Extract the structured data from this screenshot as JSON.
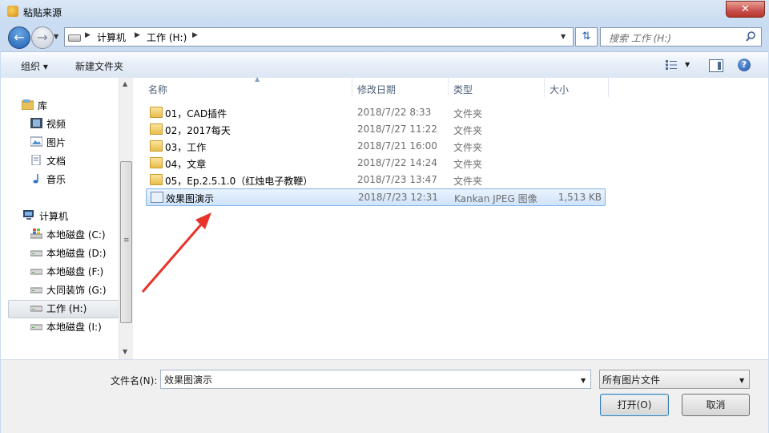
{
  "window": {
    "title": "粘贴来源",
    "close_glyph": "✕"
  },
  "nav": {
    "breadcrumbs": [
      "计算机",
      "工作 (H:)"
    ],
    "search_placeholder": "搜索 工作 (H:)"
  },
  "toolbar": {
    "organize_label": "组织 ▾",
    "new_folder_label": "新建文件夹",
    "help_glyph": "?"
  },
  "sidebar": {
    "libraries_label": "库",
    "library_items": [
      {
        "label": "视频",
        "icon": "video-icon"
      },
      {
        "label": "图片",
        "icon": "picture-icon"
      },
      {
        "label": "文档",
        "icon": "document-icon"
      },
      {
        "label": "音乐",
        "icon": "music-icon"
      }
    ],
    "computer_label": "计算机",
    "drives": [
      {
        "label": "本地磁盘 (C:)",
        "icon": "windows-drive-icon"
      },
      {
        "label": "本地磁盘 (D:)",
        "icon": "drive-icon"
      },
      {
        "label": "本地磁盘 (F:)",
        "icon": "drive-icon"
      },
      {
        "label": "大同装饰 (G:)",
        "icon": "drive-icon"
      },
      {
        "label": "工作 (H:)",
        "icon": "drive-icon",
        "selected": true
      },
      {
        "label": "本地磁盘 (I:)",
        "icon": "drive-icon"
      }
    ]
  },
  "columns": {
    "name": "名称",
    "modified": "修改日期",
    "type": "类型",
    "size": "大小"
  },
  "files": [
    {
      "name": "01，CAD插件",
      "modified": "2018/7/22 8:33",
      "type": "文件夹",
      "size": "",
      "icon": "folder-icon"
    },
    {
      "name": "02，2017每天",
      "modified": "2018/7/27 11:22",
      "type": "文件夹",
      "size": "",
      "icon": "folder-icon"
    },
    {
      "name": "03，工作",
      "modified": "2018/7/21 16:00",
      "type": "文件夹",
      "size": "",
      "icon": "folder-icon"
    },
    {
      "name": "04，文章",
      "modified": "2018/7/22 14:24",
      "type": "文件夹",
      "size": "",
      "icon": "folder-icon"
    },
    {
      "name": "05，Ep.2.5.1.0（红烛电子教鞭）",
      "modified": "2018/7/23 13:47",
      "type": "文件夹",
      "size": "",
      "icon": "folder-icon"
    },
    {
      "name": "效果图演示",
      "modified": "2018/7/23 12:31",
      "type": "Kankan JPEG 图像",
      "size": "1,513 KB",
      "icon": "jpeg-file-icon",
      "selected": true
    }
  ],
  "bottom": {
    "filename_label": "文件名(N):",
    "filename_value": "效果图演示",
    "filter_value": "所有图片文件",
    "open_label": "打开(O)",
    "cancel_label": "取消"
  },
  "colors": {
    "annotation_arrow": "#e8332a",
    "selection": "#cfe3fa",
    "frame": "#c9dcf1"
  }
}
